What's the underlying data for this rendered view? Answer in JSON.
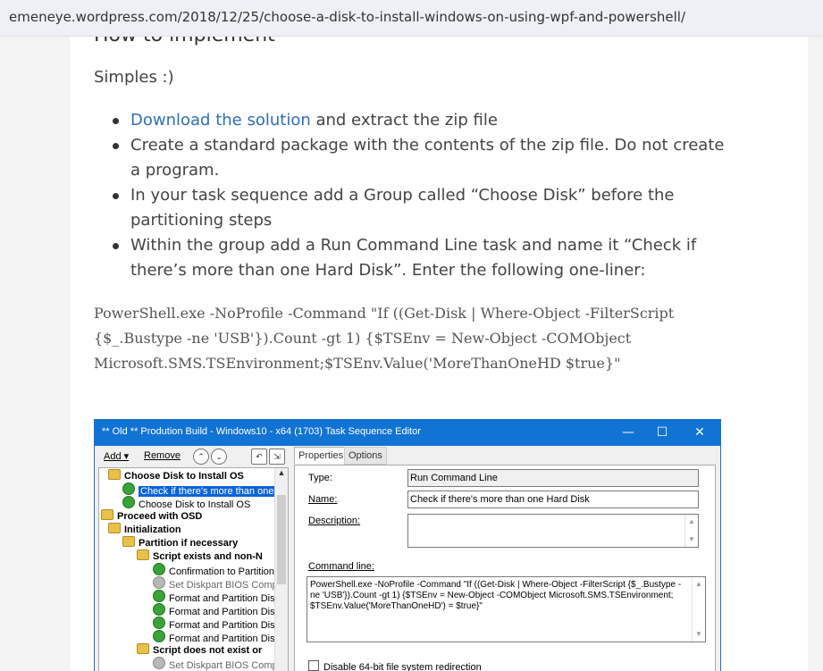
{
  "browser": {
    "url": "emeneye.wordpress.com/2018/12/25/choose-a-disk-to-install-windows-on-using-wpf-and-powershell/"
  },
  "article": {
    "cut_heading": "How to implement",
    "intro": "Simples :)",
    "bullets": [
      {
        "link": "Download the solution",
        "text": " and extract the zip file"
      },
      {
        "text": "Create a standard package with the contents of the zip file. Do not create a program."
      },
      {
        "text": "In your task sequence add a Group called “Choose Disk” before the partitioning steps"
      },
      {
        "text": "Within the group add a Run Command Line task and name it “Check if there’s more than one Hard Disk”. Enter the following one-liner:"
      }
    ],
    "code": "PowerShell.exe -NoProfile -Command \"If ((Get-Disk | Where-Object -FilterScript {$_.Bustype -ne 'USB'}).Count -gt 1) {$TSEnv = New-Object -COMObject Microsoft.SMS.TSEnvironment;$TSEnv.Value('MoreThanOneHD $true}\""
  },
  "editor": {
    "title": "** Old ** Prodution Build - Windows10 - x64 (1703) Task Sequence Editor",
    "controls": {
      "minimize": "—",
      "maximize": "☐",
      "close": "✕"
    },
    "toolbar": {
      "add": "Add ▾",
      "remove": "Remove"
    },
    "tree": [
      {
        "label": "Choose Disk to Install OS",
        "icon": "folder-icon",
        "bold": true
      },
      {
        "label": "Check if there's more than one H",
        "icon": "check-icon",
        "selected": true
      },
      {
        "label": "Choose Disk to Install OS",
        "icon": "check-icon"
      },
      {
        "label": "Proceed with OSD",
        "icon": "folder-icon",
        "bold": true
      },
      {
        "label": "Initialization",
        "icon": "folder-icon",
        "bold": true
      },
      {
        "label": "Partition if necessary",
        "icon": "folder-icon",
        "bold": true
      },
      {
        "label": "Script exists and non-N",
        "icon": "folder-icon",
        "bold": true
      },
      {
        "label": "Confirmation to Partition",
        "icon": "check-icon"
      },
      {
        "label": "Set Diskpart BIOS Comp",
        "icon": "disabled-icon",
        "dim": true
      },
      {
        "label": "Format and Partition Disk",
        "icon": "check-icon"
      },
      {
        "label": "Format and Partition Disk",
        "icon": "check-icon"
      },
      {
        "label": "Format and Partition Disk",
        "icon": "check-icon"
      },
      {
        "label": "Format and Partition Disk",
        "icon": "check-icon"
      },
      {
        "label": "Script does not exist or",
        "icon": "folder-icon",
        "bold": true
      },
      {
        "label": "Set Diskpart BIOS Comp",
        "icon": "disabled-icon",
        "dim": true
      }
    ],
    "tabs": {
      "properties": "Properties",
      "options": "Options"
    },
    "fields": {
      "type_label": "Type:",
      "type_value": "Run Command Line",
      "name_label": "Name:",
      "name_value": "Check if there's more than one Hard Disk",
      "description_label": "Description:",
      "command_label": "Command line:",
      "command_value": "PowerShell.exe -NoProfile -Command \"If ((Get-Disk | Where-Object -FilterScript {$_.Bustype -ne 'USB'}).Count -gt 1) {$TSEnv = New-Object -COMObject Microsoft.SMS.TSEnvironment; $TSEnv.Value('MoreThanOneHD') = $true}\"",
      "disable64_label": "Disable 64-bit file system redirection"
    }
  }
}
